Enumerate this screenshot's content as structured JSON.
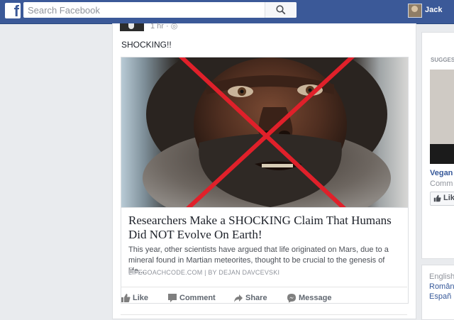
{
  "topbar": {
    "logo": "f",
    "search_placeholder": "Search Facebook",
    "user_name": "Jack"
  },
  "post": {
    "time": "1 hr · ◎",
    "text": "SHOCKING!!",
    "link": {
      "title": "Researchers Make a SHOCKING Claim That Humans Did NOT Evolve On Earth!",
      "description": "This year, other scientists have argued that life originated on Mars, due to a mineral found in Martian meteorites, thought to be crucial to the genesis of life....",
      "source": "LIFECOACHCODE.COM | BY DEJAN DAVCEVSKI"
    },
    "actions": {
      "like": "Like",
      "comment": "Comment",
      "share": "Share",
      "message": "Message"
    }
  },
  "rail": {
    "heading": "SUGGES",
    "title": "Vegan",
    "subtitle": "Comm",
    "like": "Lik"
  },
  "languages": [
    "English",
    "Român",
    "Españ"
  ],
  "colors": {
    "brand": "#3b5998",
    "link": "#365899",
    "cross": "#e0202a"
  }
}
